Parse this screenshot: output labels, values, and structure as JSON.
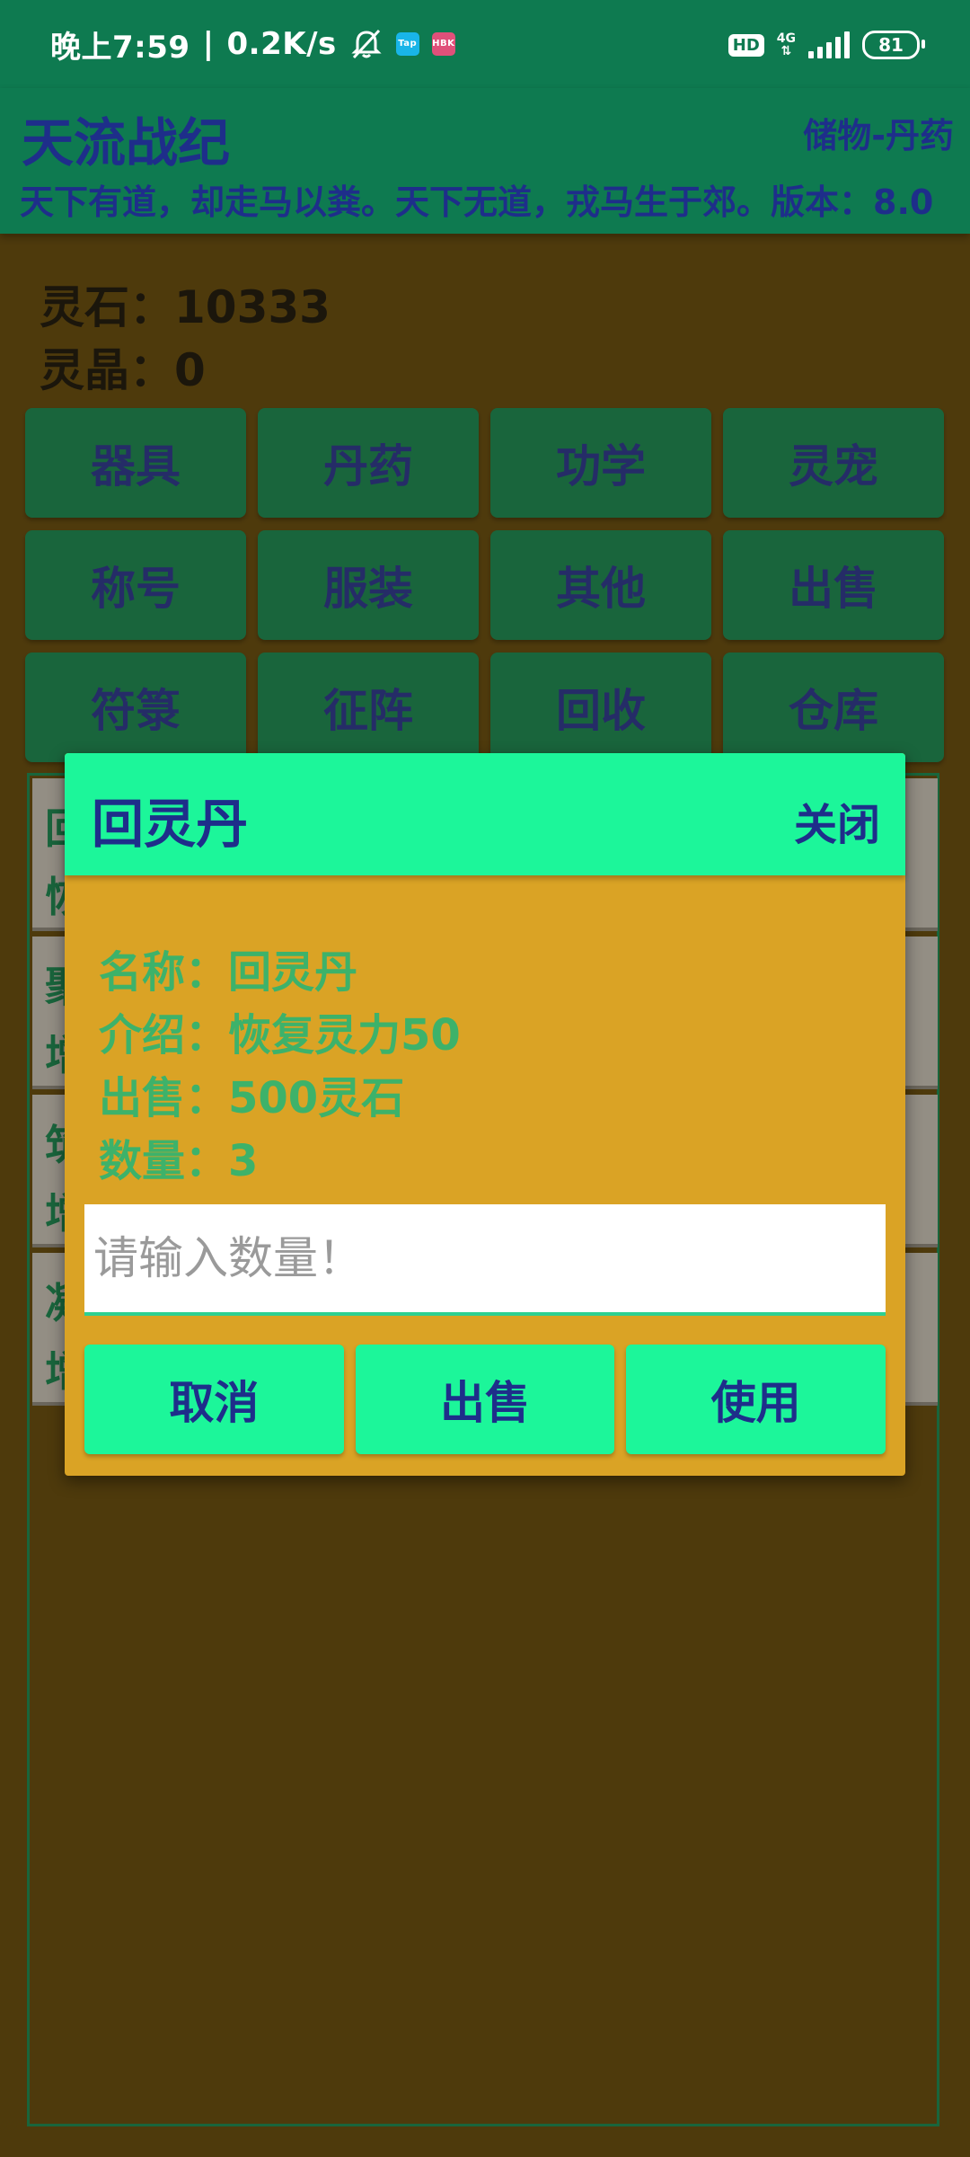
{
  "status_bar": {
    "time": "晚上7:59",
    "net_speed": "0.2K/s",
    "hd_label": "HD",
    "net_type": "4G",
    "battery": "81",
    "icons": [
      "bell-off-icon",
      "taptap-app-icon",
      "hbk-app-icon",
      "signal-icon",
      "battery-icon"
    ]
  },
  "header": {
    "title": "天流战纪",
    "section": "储物-丹药",
    "motto": "天下有道，却走马以粪。天下无道，戎马生于郊。版本：8.0"
  },
  "currency": {
    "spirit_stone": "灵石：10333",
    "spirit_crystal": "灵晶：0"
  },
  "categories": [
    "器具",
    "丹药",
    "功学",
    "灵宠",
    "称号",
    "服装",
    "其他",
    "出售",
    "符箓",
    "征阵",
    "回收",
    "仓库"
  ],
  "list_partial_chars": [
    [
      "回",
      "恢"
    ],
    [
      "聚",
      "增"
    ],
    [
      "筑",
      "增"
    ],
    [
      "凝",
      "增"
    ]
  ],
  "dialog": {
    "title": "回灵丹",
    "close_label": "关闭",
    "name_line": "名称：回灵丹",
    "desc_line": "介绍：恢复灵力50",
    "price_line": "出售：500灵石",
    "qty_line": "数量：3",
    "input_placeholder": "请输入数量！",
    "input_value": "",
    "buttons": {
      "cancel": "取消",
      "sell": "出售",
      "use": "使用"
    }
  },
  "colors": {
    "primary": "#0E7A50",
    "accent": "#1CF69A",
    "dialog_bg": "#DAA325",
    "page_bg": "#544011",
    "text_dark_blue": "#1E2E8A",
    "info_green": "#3DB26A"
  }
}
